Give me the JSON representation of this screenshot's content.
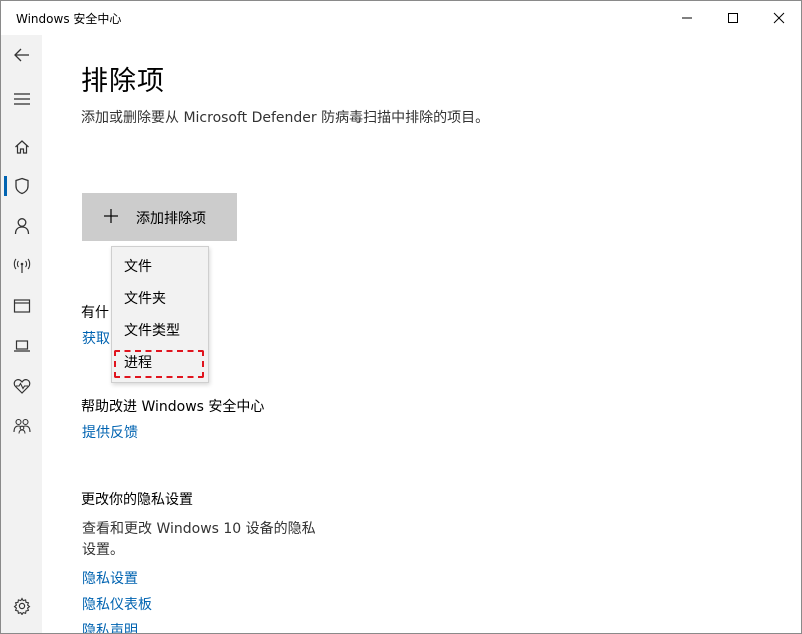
{
  "window": {
    "title": "Windows 安全中心",
    "controls": {
      "minimize_icon": "minimize-icon",
      "maximize_icon": "maximize-icon",
      "close_icon": "close-icon"
    }
  },
  "rail": {
    "items": [
      {
        "icon": "back-arrow-icon"
      },
      {
        "icon": "hamburger-menu-icon"
      },
      {
        "icon": "home-icon"
      },
      {
        "icon": "shield-icon",
        "selected": true
      },
      {
        "icon": "person-icon"
      },
      {
        "icon": "wireless-antenna-icon"
      },
      {
        "icon": "app-browser-icon"
      },
      {
        "icon": "laptop-icon"
      },
      {
        "icon": "heart-pulse-icon"
      },
      {
        "icon": "family-icon"
      },
      {
        "icon": "gear-icon"
      }
    ],
    "accent_color": "#0063b1"
  },
  "main": {
    "title": "排除项",
    "description": "添加或删除要从 Microsoft Defender 防病毒扫描中排除的项目。",
    "add_button": {
      "label": "添加排除项",
      "icon": "plus-icon"
    },
    "questions": {
      "heading": "有什",
      "link": "获取"
    },
    "feedback": {
      "heading": "帮助改进 Windows 安全中心",
      "link": "提供反馈"
    },
    "privacy": {
      "heading": "更改你的隐私设置",
      "text_line1": "查看和更改 Windows 10 设备的隐私",
      "text_line2": "设置。",
      "links": [
        "隐私设置",
        "隐私仪表板",
        "隐私声明"
      ]
    },
    "link_color": "#0063b1"
  },
  "dropdown": {
    "items": [
      "文件",
      "文件夹",
      "文件类型",
      "进程"
    ],
    "highlight_color": "#e0141e"
  }
}
